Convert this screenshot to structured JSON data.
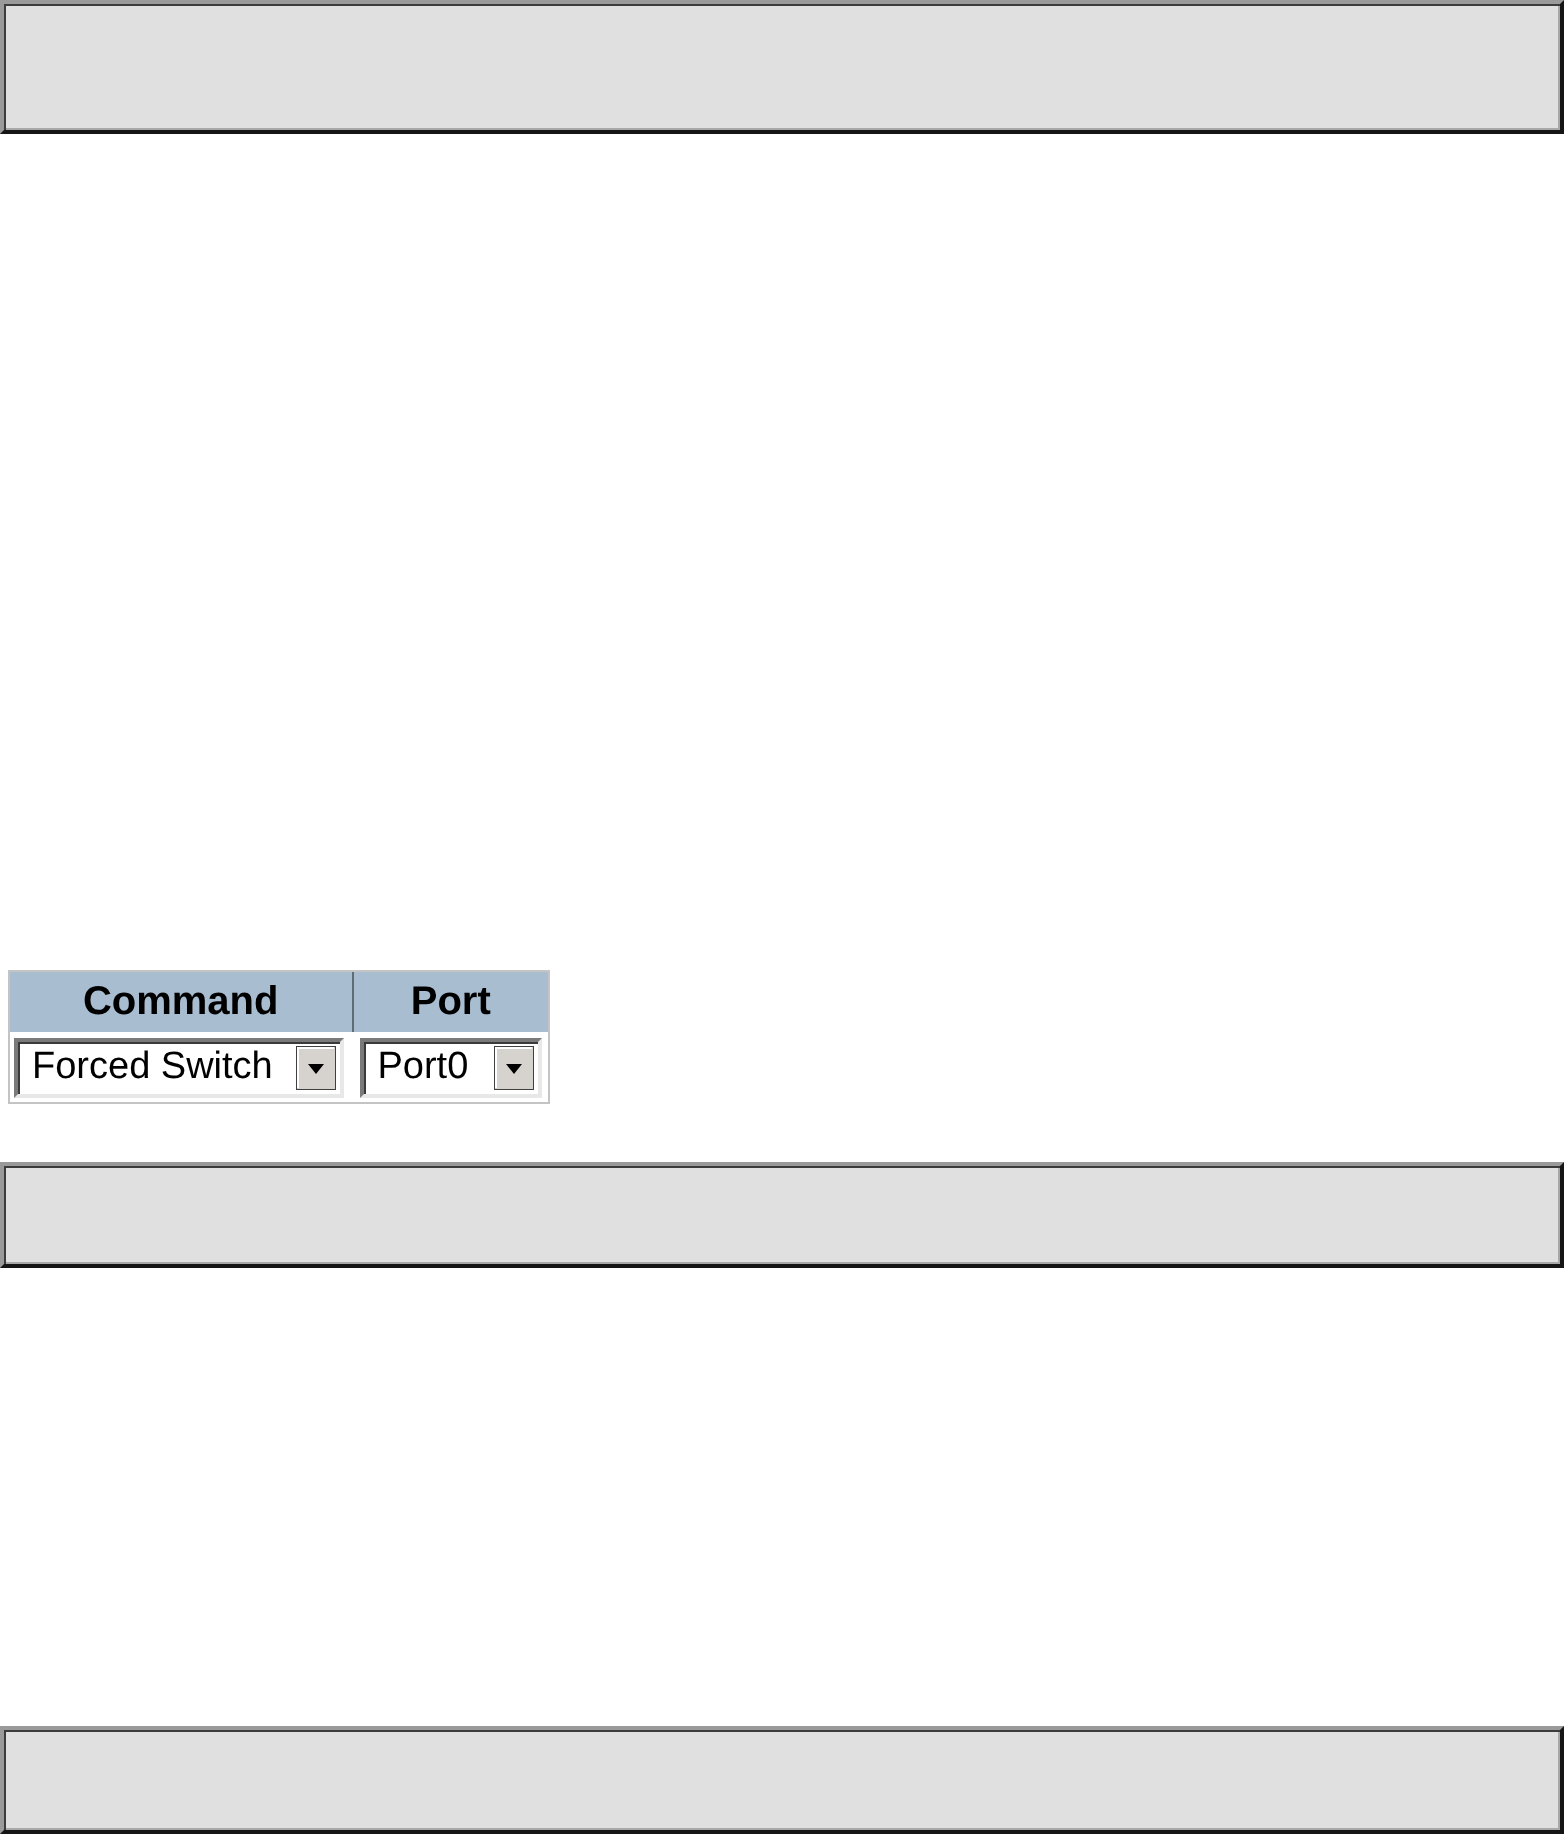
{
  "table": {
    "columns": [
      "Command",
      "Port"
    ],
    "rows": [
      {
        "cells": [
          "Forced Switch",
          "Port0"
        ]
      }
    ]
  }
}
